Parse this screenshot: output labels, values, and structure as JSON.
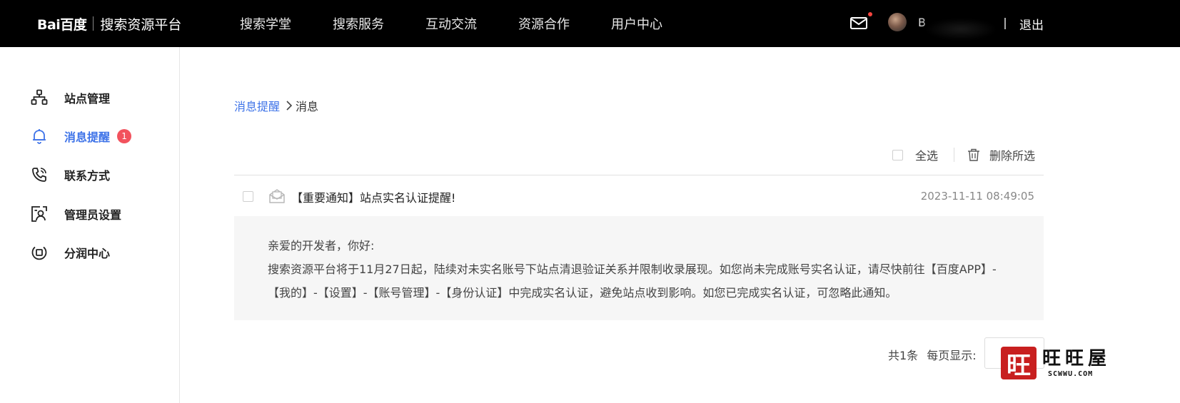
{
  "header": {
    "logo_text": "Bai百度",
    "platform_name": "搜索资源平台",
    "nav": [
      "搜索学堂",
      "搜索服务",
      "互动交流",
      "资源合作",
      "用户中心"
    ],
    "username": "B",
    "logout": "退出",
    "icons": {
      "mail": "mail-icon",
      "notification_dot_color": "#f5453f"
    }
  },
  "sidebar": {
    "items": [
      {
        "label": "站点管理",
        "icon": "sitemap-icon",
        "active": false
      },
      {
        "label": "消息提醒",
        "icon": "bell-icon",
        "active": true,
        "badge": "1"
      },
      {
        "label": "联系方式",
        "icon": "phone-icon",
        "active": false
      },
      {
        "label": "管理员设置",
        "icon": "admin-icon",
        "active": false
      },
      {
        "label": "分润中心",
        "icon": "revenue-icon",
        "active": false
      }
    ],
    "active_color": "#3e73e8",
    "badge_color": "#f2525d"
  },
  "breadcrumb": {
    "parent": "消息提醒",
    "current": "消息"
  },
  "toolbar": {
    "select_all": "全选",
    "delete_selected": "删除所选"
  },
  "messages": [
    {
      "title": "【重要通知】站点实名认证提醒!",
      "time": "2023-11-11 08:49:05",
      "body": [
        "亲爱的开发者，你好:",
        "搜索资源平台将于11月27日起，陆续对未实名账号下站点清退验证关系并限制收录展现。如您尚未完成账号实名认证，请尽快前往【百度APP】-",
        "【我的】-【设置】-【账号管理】-【身份认证】中完成实名认证，避免站点收到影响。如您已完成实名认证，可忽略此通知。"
      ]
    }
  ],
  "pagination": {
    "total": "共1条",
    "per_page_label": "每页显示:"
  },
  "watermark": {
    "seal_char": "旺",
    "name": "旺旺屋",
    "url": "SCWWU.COM"
  }
}
